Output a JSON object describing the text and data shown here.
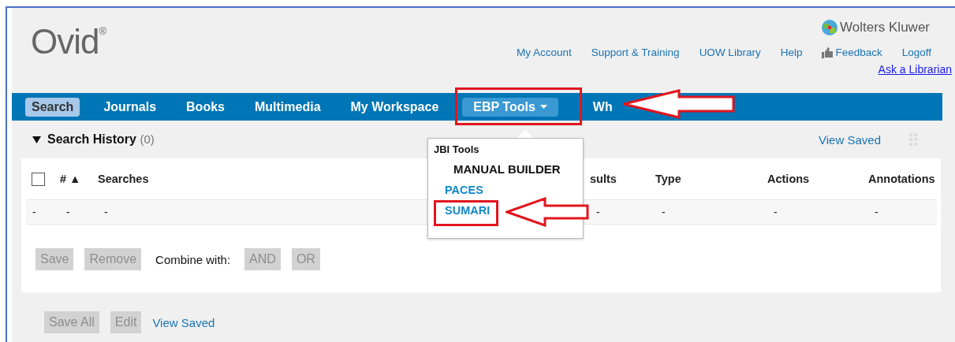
{
  "logo": {
    "text": "Ovid",
    "mark": "®"
  },
  "brand": "Wolters Kluwer",
  "top_links": [
    {
      "label": "My Account",
      "kind": "text"
    },
    {
      "label": "Support & Training",
      "kind": "text"
    },
    {
      "label": "UOW Library",
      "kind": "text"
    },
    {
      "label": "Help",
      "kind": "text"
    },
    {
      "label": "Feedback",
      "kind": "thumb"
    },
    {
      "label": "Logoff",
      "kind": "text"
    }
  ],
  "ask_link": "Ask a Librarian",
  "nav": [
    {
      "label": "Search",
      "selected": true,
      "expanded": false,
      "caret": false
    },
    {
      "label": "Journals",
      "selected": false,
      "expanded": false,
      "caret": false
    },
    {
      "label": "Books",
      "selected": false,
      "expanded": false,
      "caret": false
    },
    {
      "label": "Multimedia",
      "selected": false,
      "expanded": false,
      "caret": false
    },
    {
      "label": "My Workspace",
      "selected": false,
      "expanded": false,
      "caret": false
    },
    {
      "label": "EBP Tools",
      "selected": false,
      "expanded": true,
      "caret": true
    },
    {
      "label": "Wh",
      "selected": false,
      "expanded": false,
      "caret": false
    }
  ],
  "search_history": {
    "title": "Search History",
    "count": "(0)",
    "expanded": true,
    "view_saved": "View Saved",
    "header_checkbox": {
      "checked": false
    },
    "columns": [
      "",
      "# ▲",
      "Searches",
      "sults",
      "Type",
      "Actions",
      "Annotations"
    ],
    "rows": [
      [
        "-",
        "-",
        "-",
        "-",
        "-",
        "-",
        "-"
      ]
    ],
    "buttons": [
      {
        "label": "Save",
        "disabled": true
      },
      {
        "label": "Remove",
        "disabled": true
      }
    ],
    "combine_label": "Combine with:",
    "combine_buttons": [
      {
        "label": "AND",
        "disabled": true
      },
      {
        "label": "OR",
        "disabled": true
      }
    ]
  },
  "footer_buttons": [
    {
      "label": "Save All",
      "disabled": true
    },
    {
      "label": "Edit",
      "disabled": true
    }
  ],
  "footer_link": "View Saved",
  "dropdown": {
    "heading": "JBI Tools",
    "items": [
      {
        "label": "MANUAL BUILDER",
        "kind": "heading"
      },
      {
        "label": "PACES",
        "kind": "link"
      },
      {
        "label": "SUMARI",
        "kind": "link"
      }
    ]
  }
}
